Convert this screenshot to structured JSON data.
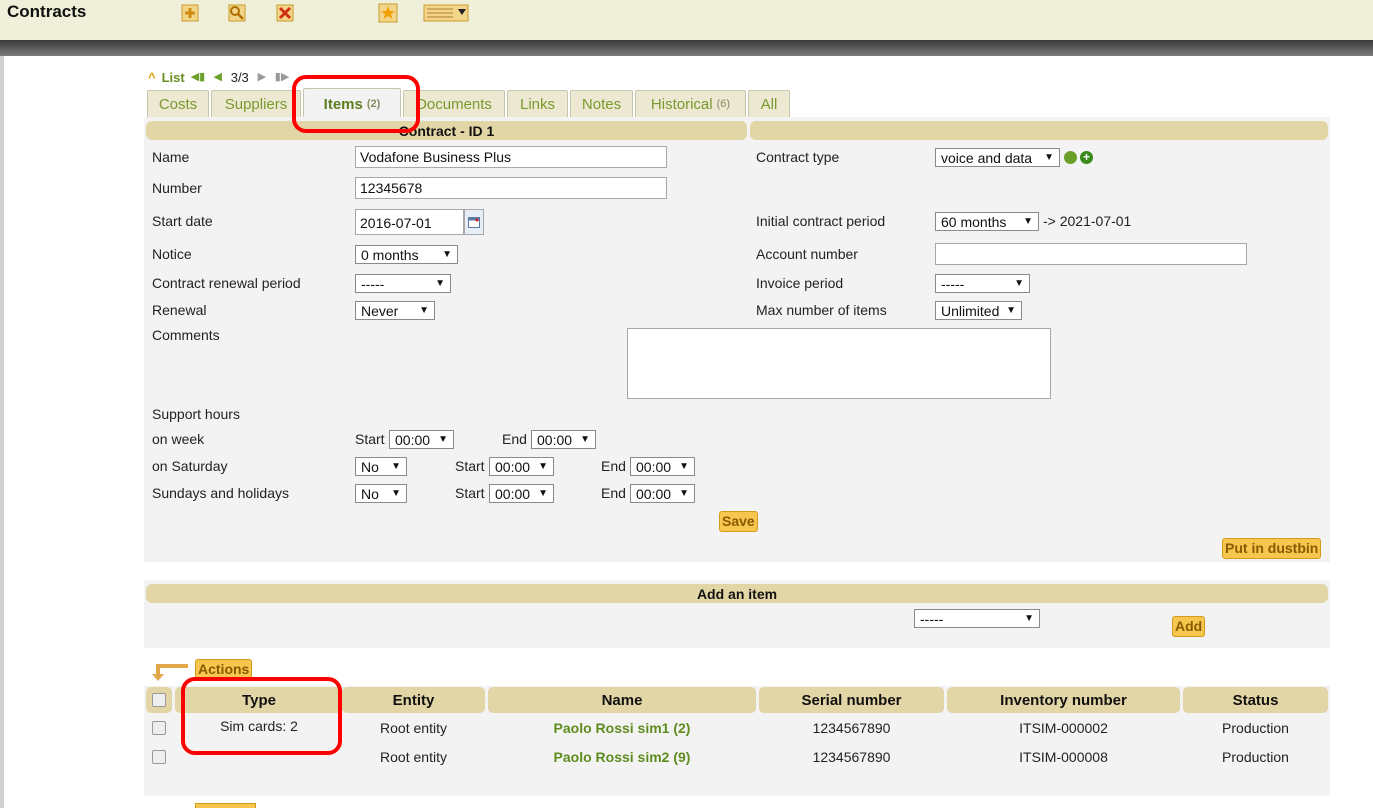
{
  "app": {
    "title": "Contracts"
  },
  "toolbar": {
    "icons": [
      "add-icon",
      "search-icon",
      "delete-icon",
      "favorite-icon",
      "columns-icon"
    ]
  },
  "nav": {
    "list_label": "List",
    "position": "3/3"
  },
  "tabs": [
    {
      "label": "Costs",
      "count": ""
    },
    {
      "label": "Suppliers",
      "count": ""
    },
    {
      "label": "Items",
      "count": "(2)"
    },
    {
      "label": "Documents",
      "count": ""
    },
    {
      "label": "Links",
      "count": ""
    },
    {
      "label": "Notes",
      "count": ""
    },
    {
      "label": "Historical",
      "count": "(6)"
    },
    {
      "label": "All",
      "count": ""
    }
  ],
  "contract": {
    "header": "Contract - ID 1",
    "name_label": "Name",
    "name_value": "Vodafone Business Plus",
    "number_label": "Number",
    "number_value": "12345678",
    "start_label": "Start date",
    "start_value": "2016-07-01",
    "notice_label": "Notice",
    "notice_value": "0 months",
    "renewal_period_label": "Contract renewal period",
    "renewal_period_value": "-----",
    "renewal_label": "Renewal",
    "renewal_value": "Never",
    "comments_label": "Comments",
    "type_label": "Contract type",
    "type_value": "voice and data",
    "initial_label": "Initial contract period",
    "initial_value": "60 months",
    "initial_end": "-> 2021-07-01",
    "account_label": "Account number",
    "invoice_label": "Invoice period",
    "invoice_value": "-----",
    "maxitems_label": "Max number of items",
    "maxitems_value": "Unlimited",
    "support_label": "Support hours",
    "week_label": "on week",
    "saturday_label": "on Saturday",
    "sunday_label": "Sundays and holidays",
    "start_word": "Start",
    "end_word": "End",
    "week_start": "00:00",
    "week_end": "00:00",
    "sat_enabled": "No",
    "sat_start": "00:00",
    "sat_end": "00:00",
    "sun_enabled": "No",
    "sun_start": "00:00",
    "sun_end": "00:00",
    "save_label": "Save",
    "dustbin_label": "Put in dustbin"
  },
  "add_item": {
    "header": "Add an item",
    "select_value": "-----",
    "add_label": "Add"
  },
  "items": {
    "actions_label": "Actions",
    "columns": [
      "Type",
      "Entity",
      "Name",
      "Serial number",
      "Inventory number",
      "Status"
    ],
    "type_summary": "Sim cards: 2",
    "rows": [
      {
        "entity": "Root entity",
        "name": "Paolo Rossi sim1 (2)",
        "serial": "1234567890",
        "inventory": "ITSIM-000002",
        "status": "Production"
      },
      {
        "entity": "Root entity",
        "name": "Paolo Rossi sim2 (9)",
        "serial": "1234567890",
        "inventory": "ITSIM-000008",
        "status": "Production"
      }
    ]
  }
}
